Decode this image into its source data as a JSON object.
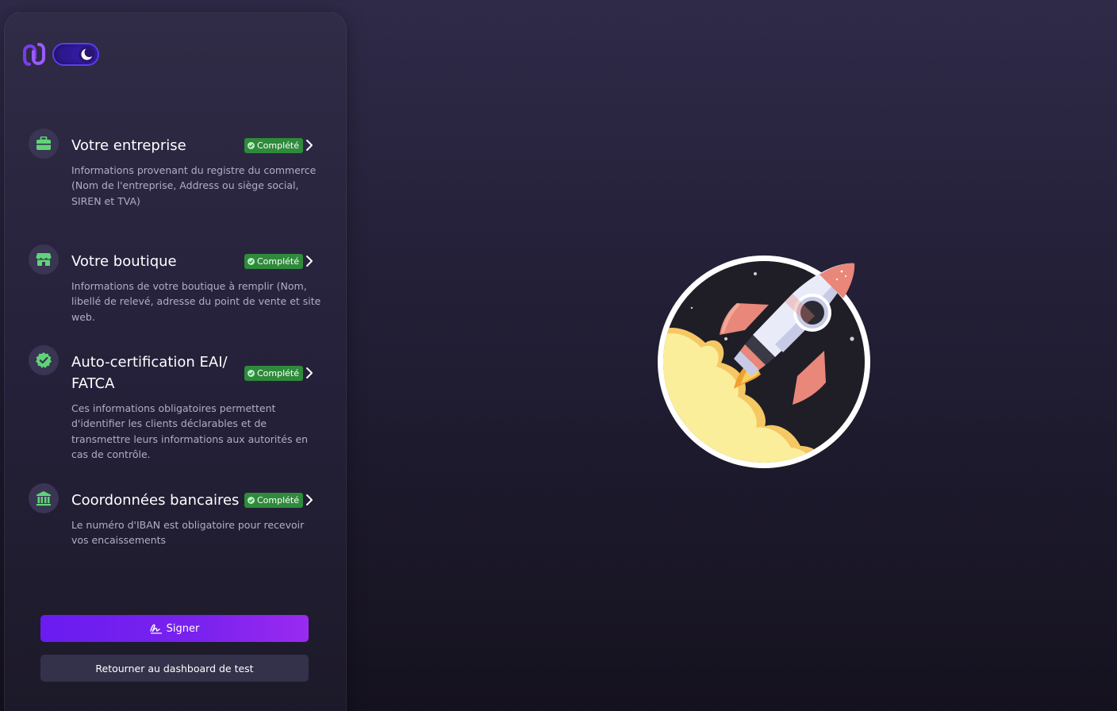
{
  "header": {
    "logo_icon": "link-chain-logo",
    "theme_toggle": {
      "icon": "moon-icon",
      "state": "dark"
    }
  },
  "steps": [
    {
      "icon": "briefcase-icon",
      "title": "Votre entreprise",
      "status": "Complété",
      "description": "Informations provenant du registre du commerce (Nom de l'entreprise, Address ou siège social, SIREN et TVA)"
    },
    {
      "icon": "store-icon",
      "title": "Votre boutique",
      "status": "Complété",
      "description": "Informations de votre boutique à remplir (Nom, libellé de relevé, adresse du point de vente et site web."
    },
    {
      "icon": "badge-check-icon",
      "title": "Auto-certification EAI/ FATCA",
      "status": "Complété",
      "description": "Ces informations obligatoires permettent d'identifier les clients déclarables et de transmettre leurs informations aux autorités en cas de contrôle."
    },
    {
      "icon": "bank-icon",
      "title": "Coordonnées bancaires",
      "status": "Complété",
      "description": "Le numéro d'IBAN est obligatoire pour recevoir vos encaissements"
    }
  ],
  "actions": {
    "sign_label": "Signer",
    "sign_icon": "signature-icon",
    "back_label": "Retourner au dashboard de test"
  },
  "colors": {
    "accent": "#7a22ee",
    "success": "#2f8a3c",
    "icon_green": "#5fd477"
  }
}
